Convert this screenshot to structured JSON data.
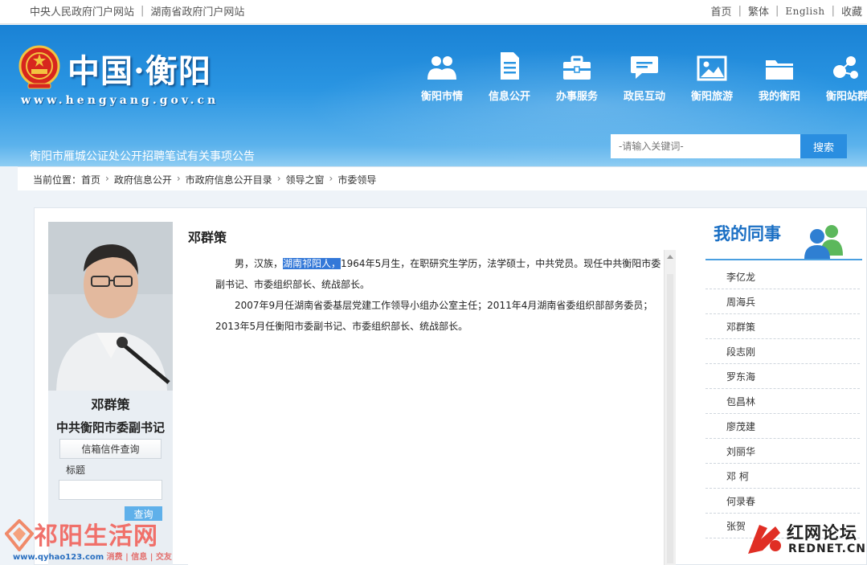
{
  "topbar": {
    "left_links": [
      "中央人民政府门户网站",
      "湖南省政府门户网站"
    ],
    "right_links": [
      "首页",
      "繁体",
      "English",
      "收藏"
    ]
  },
  "header": {
    "site_title": "中国·衡阳",
    "site_url": "www.hengyang.gov.cn",
    "nav": [
      {
        "label": "衡阳市情",
        "icon": "people-icon"
      },
      {
        "label": "信息公开",
        "icon": "document-icon"
      },
      {
        "label": "办事服务",
        "icon": "briefcase-icon"
      },
      {
        "label": "政民互动",
        "icon": "chat-icon"
      },
      {
        "label": "衡阳旅游",
        "icon": "picture-icon"
      },
      {
        "label": "我的衡阳",
        "icon": "folder-icon"
      },
      {
        "label": "衡阳站群",
        "icon": "network-icon"
      }
    ],
    "notice": "衡阳市雁城公证处公开招聘笔试有关事项公告",
    "search_placeholder": "-请输入关键词-",
    "search_button": "搜索"
  },
  "breadcrumb": {
    "prefix": "当前位置：",
    "items": [
      "首页",
      "政府信息公开",
      "市政府信息公开目录",
      "领导之窗",
      "市委领导"
    ]
  },
  "profile": {
    "name": "邓群策",
    "position": "中共衡阳市委副书记",
    "mail_button": "信箱信件查询",
    "title_label": "标题",
    "query_button": "查询"
  },
  "article": {
    "title": "邓群策",
    "para1_a": "男，汉族，",
    "para1_hl": "湖南祁阳人，",
    "para1_b": "1964年5月生，在职研究生学历，法学硕士，中共党员。现任中共衡阳市委副书记、市委组织部长、统战部长。",
    "para2": "2007年9月任湖南省委基层党建工作领导小组办公室主任；2011年4月湖南省委组织部部务委员；2013年5月任衡阳市委副书记、市委组织部长、统战部长。"
  },
  "colleagues": {
    "heading": "我的同事",
    "names": [
      "李亿龙",
      "周海兵",
      "邓群策",
      "段志刚",
      "罗东海",
      "包昌林",
      "廖茂建",
      "刘丽华",
      "邓 柯",
      "何录春",
      "张贺"
    ]
  },
  "watermarks": {
    "left_logo": "祁阳生活网",
    "left_url": "www.qyhao123.com",
    "left_tags": "消费 | 信息 | 交友",
    "right_cn": "红网论坛",
    "right_en": "REDNET.CN"
  },
  "colors": {
    "header_blue": "#1a82d5",
    "accent_blue": "#2a8ee0",
    "highlight": "#3378d8",
    "watermark_red": "#f0706a"
  }
}
